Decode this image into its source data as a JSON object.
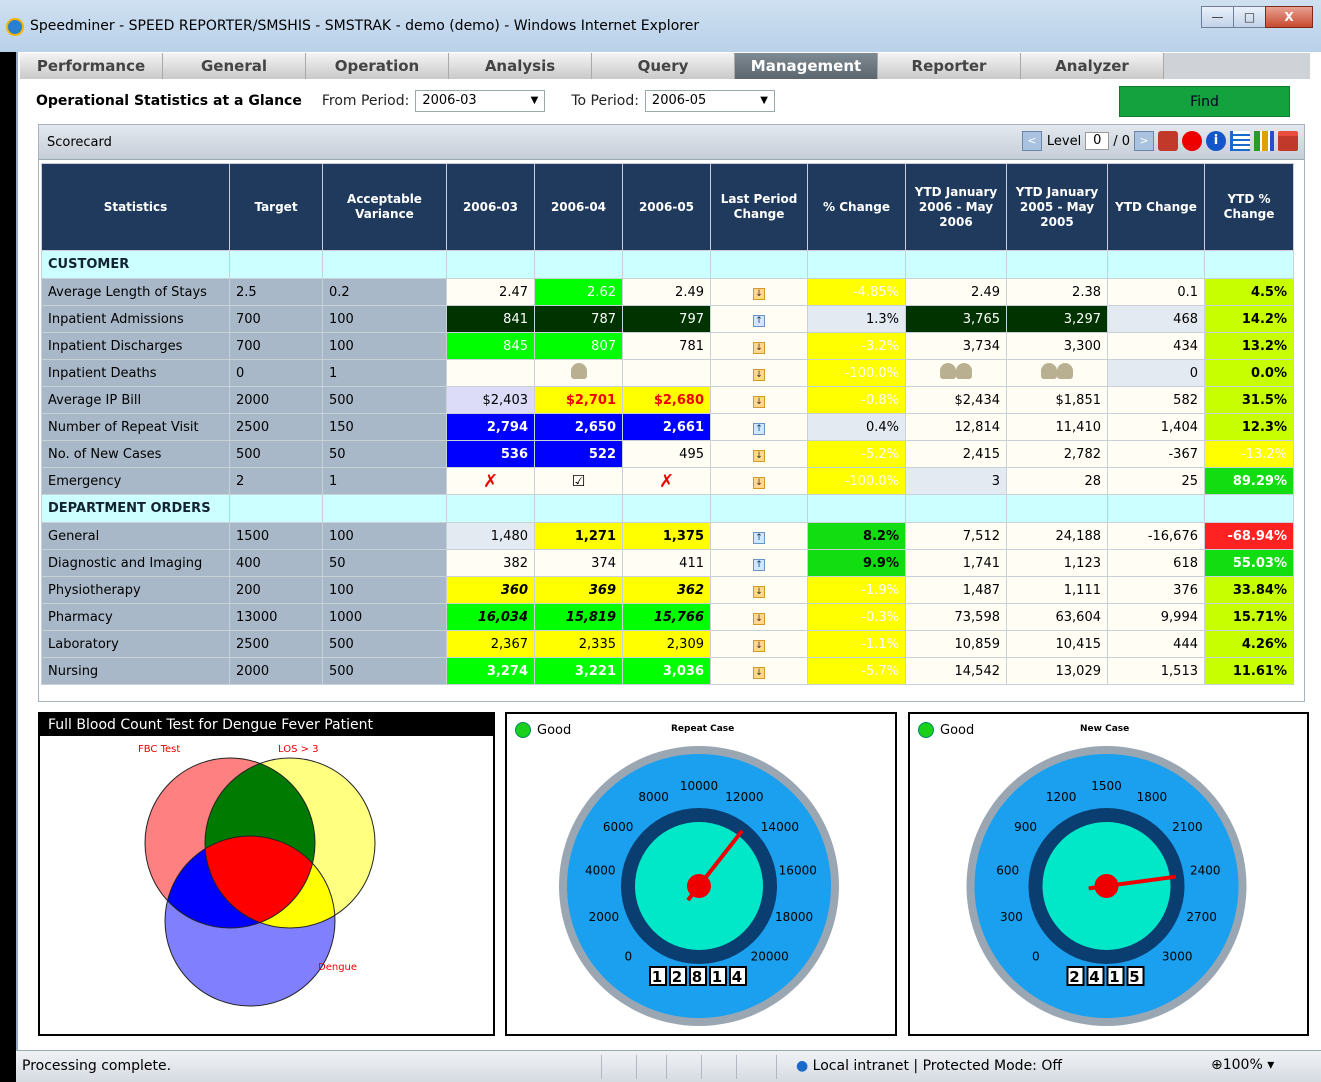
{
  "window": {
    "title": "Speedminer - SPEED REPORTER/SMSHIS - SMSTRAK - demo (demo) - Windows Internet Explorer"
  },
  "nav": [
    "Performance",
    "General",
    "Operation",
    "Analysis",
    "Query",
    "Management",
    "Reporter",
    "Analyzer"
  ],
  "nav_active": "Management",
  "filter": {
    "label": "Operational Statistics at a Glance",
    "from_label": "From Period:",
    "from_value": "2006-03",
    "to_label": "To Period:",
    "to_value": "2006-05",
    "find": "Find"
  },
  "scorecard": {
    "title": "Scorecard",
    "level_label": "Level",
    "level_value": "0",
    "level_total": "/ 0"
  },
  "columns": [
    "Statistics",
    "Target",
    "Acceptable Variance",
    "2006-03",
    "2006-04",
    "2006-05",
    "Last Period Change",
    "% Change",
    "YTD January 2006 - May 2006",
    "YTD January 2005 - May 2005",
    "YTD Change",
    "YTD % Change"
  ],
  "sections": [
    {
      "name": "CUSTOMER",
      "rows": [
        {
          "stat": "Average Length of Stays",
          "target": "2.5",
          "var": "0.2",
          "m1": "2.47",
          "m2": "2.62",
          "m3": "2.49",
          "pct": "-4.85%",
          "y1": "2.49",
          "y2": "2.38",
          "yc": "0.1",
          "yp": "4.5%"
        },
        {
          "stat": "Inpatient Admissions",
          "target": "700",
          "var": "100",
          "m1": "841",
          "m2": "787",
          "m3": "797",
          "pct": "1.3%",
          "y1": "3,765",
          "y2": "3,297",
          "yc": "468",
          "yp": "14.2%"
        },
        {
          "stat": "Inpatient Discharges",
          "target": "700",
          "var": "100",
          "m1": "845",
          "m2": "807",
          "m3": "781",
          "pct": "-3.2%",
          "y1": "3,734",
          "y2": "3,300",
          "yc": "434",
          "yp": "13.2%"
        },
        {
          "stat": "Inpatient Deaths",
          "target": "0",
          "var": "1",
          "m1": "",
          "m2": "",
          "m3": "",
          "pct": "-100.0%",
          "y1": "",
          "y2": "",
          "yc": "0",
          "yp": "0.0%"
        },
        {
          "stat": "Average IP Bill",
          "target": "2000",
          "var": "500",
          "m1": "$2,403",
          "m2": "$2,701",
          "m3": "$2,680",
          "pct": "-0.8%",
          "y1": "$2,434",
          "y2": "$1,851",
          "yc": "582",
          "yp": "31.5%"
        },
        {
          "stat": "Number of Repeat Visit",
          "target": "2500",
          "var": "150",
          "m1": "2,794",
          "m2": "2,650",
          "m3": "2,661",
          "pct": "0.4%",
          "y1": "12,814",
          "y2": "11,410",
          "yc": "1,404",
          "yp": "12.3%"
        },
        {
          "stat": "No. of New Cases",
          "target": "500",
          "var": "50",
          "m1": "536",
          "m2": "522",
          "m3": "495",
          "pct": "-5.2%",
          "y1": "2,415",
          "y2": "2,782",
          "yc": "-367",
          "yp": "-13.2%"
        },
        {
          "stat": "Emergency",
          "target": "2",
          "var": "1",
          "m1": "",
          "m2": "",
          "m3": "",
          "pct": "-100.0%",
          "y1": "3",
          "y2": "28",
          "yc": "25",
          "yp": "89.29%"
        }
      ]
    },
    {
      "name": "DEPARTMENT ORDERS",
      "rows": [
        {
          "stat": "General",
          "target": "1500",
          "var": "100",
          "m1": "1,480",
          "m2": "1,271",
          "m3": "1,375",
          "pct": "8.2%",
          "y1": "7,512",
          "y2": "24,188",
          "yc": "-16,676",
          "yp": "-68.94%"
        },
        {
          "stat": "Diagnostic and Imaging",
          "target": "400",
          "var": "50",
          "m1": "382",
          "m2": "374",
          "m3": "411",
          "pct": "9.9%",
          "y1": "1,741",
          "y2": "1,123",
          "yc": "618",
          "yp": "55.03%"
        },
        {
          "stat": "Physiotherapy",
          "target": "200",
          "var": "100",
          "m1": "360",
          "m2": "369",
          "m3": "362",
          "pct": "-1.9%",
          "y1": "1,487",
          "y2": "1,111",
          "yc": "376",
          "yp": "33.84%"
        },
        {
          "stat": "Pharmacy",
          "target": "13000",
          "var": "1000",
          "m1": "16,034",
          "m2": "15,819",
          "m3": "15,766",
          "pct": "-0.3%",
          "y1": "73,598",
          "y2": "63,604",
          "yc": "9,994",
          "yp": "15.71%"
        },
        {
          "stat": "Laboratory",
          "target": "2500",
          "var": "500",
          "m1": "2,367",
          "m2": "2,335",
          "m3": "2,309",
          "pct": "-1.1%",
          "y1": "10,859",
          "y2": "10,415",
          "yc": "444",
          "yp": "4.26%"
        },
        {
          "stat": "Nursing",
          "target": "2000",
          "var": "500",
          "m1": "3,274",
          "m2": "3,221",
          "m3": "3,036",
          "pct": "-5.7%",
          "y1": "14,542",
          "y2": "13,029",
          "yc": "1,513",
          "yp": "11.61%"
        }
      ]
    }
  ],
  "venn": {
    "title": "Full Blood Count Test for Dengue Fever Patient",
    "labels": [
      "FBC Test",
      "LOS > 3",
      "Dengue"
    ]
  },
  "gauge1": {
    "status": "Good",
    "title": "Repeat Case",
    "ticks": [
      "0",
      "2000",
      "4000",
      "6000",
      "8000",
      "10000",
      "12000",
      "14000",
      "16000",
      "18000",
      "20000"
    ],
    "value": 12814,
    "max": 20000,
    "odometer": "12814"
  },
  "gauge2": {
    "status": "Good",
    "title": "New Case",
    "ticks": [
      "0",
      "300",
      "600",
      "900",
      "1200",
      "1500",
      "1800",
      "2100",
      "2400",
      "2700",
      "3000"
    ],
    "value": 2415,
    "max": 3000,
    "odometer": "2415"
  },
  "status": {
    "text": "Processing complete.",
    "zone": "Local intranet | Protected Mode: Off",
    "zoom": "100%"
  }
}
